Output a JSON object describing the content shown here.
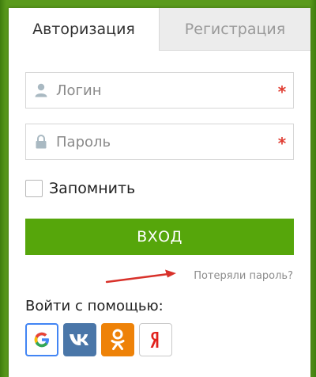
{
  "tabs": {
    "login": "Авторизация",
    "register": "Регистрация"
  },
  "fields": {
    "login_placeholder": "Логин",
    "password_placeholder": "Пароль",
    "required_mark": "*"
  },
  "remember": {
    "label": "Запомнить",
    "checked": false
  },
  "submit": {
    "label": "ВХОД"
  },
  "forgot": {
    "label": "Потеряли пароль?"
  },
  "social": {
    "title": "Войти с помощью:",
    "providers": [
      {
        "name": "google",
        "icon": "google-icon"
      },
      {
        "name": "vk",
        "icon": "vk-icon"
      },
      {
        "name": "odnoklassniki",
        "icon": "odnoklassniki-icon"
      },
      {
        "name": "yandex",
        "icon": "yandex-icon"
      }
    ]
  },
  "colors": {
    "accent_green": "#56a60b",
    "background_green": "#5a9a1c",
    "required_red": "#e03c31",
    "arrow_red": "#d8312a"
  }
}
